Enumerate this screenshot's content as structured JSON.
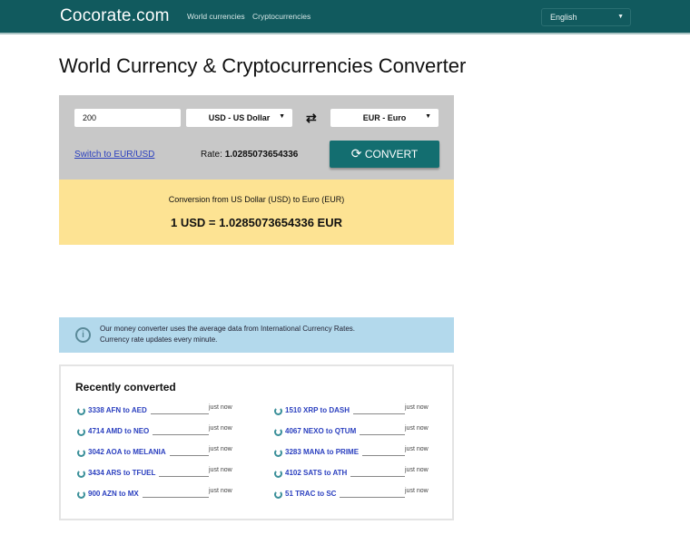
{
  "header": {
    "logo": "Cocorate.com",
    "nav": [
      "World currencies",
      "Cryptocurrencies"
    ],
    "language": "English"
  },
  "page_title": "World Currency & Cryptocurrencies Converter",
  "converter": {
    "amount": "200",
    "from": "USD - US Dollar",
    "to": "EUR - Euro",
    "switch_link": "Switch to EUR/USD",
    "rate_label": "Rate:",
    "rate_value": "1.0285073654336",
    "convert_label": "CONVERT"
  },
  "result": {
    "description": "Conversion from US Dollar (USD) to Euro (EUR)",
    "value": "1 USD = 1.0285073654336 EUR"
  },
  "info": {
    "line1": "Our money converter uses the average data from International Currency Rates.",
    "line2": "Currency rate updates every minute."
  },
  "recent": {
    "title": "Recently converted",
    "items": [
      {
        "label": "3338 AFN to AED",
        "time": "just now"
      },
      {
        "label": "1510 XRP to DASH",
        "time": "just now"
      },
      {
        "label": "4714 AMD to NEO",
        "time": "just now"
      },
      {
        "label": "4067 NEXO to QTUM",
        "time": "just now"
      },
      {
        "label": "3042 AOA to MELANIA",
        "time": "just now"
      },
      {
        "label": "3283 MANA to PRIME",
        "time": "just now"
      },
      {
        "label": "3434 ARS to TFUEL",
        "time": "just now"
      },
      {
        "label": "4102 SATS to ATH",
        "time": "just now"
      },
      {
        "label": "900 AZN to MX",
        "time": "just now"
      },
      {
        "label": "51 TRAC to SC",
        "time": "just now"
      }
    ]
  }
}
